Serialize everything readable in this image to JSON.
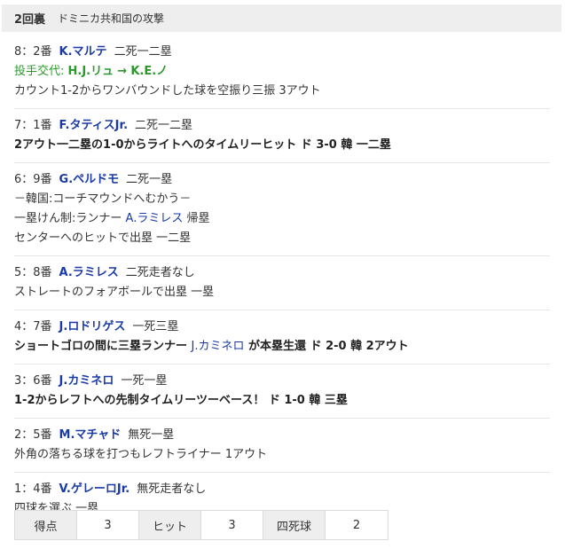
{
  "header": {
    "inning": "2回裏",
    "attack": "ドミニカ共和国の攻撃"
  },
  "entries": [
    {
      "num": "8：2番",
      "player": "K.マルテ",
      "situation": "二死一二塁",
      "sub": {
        "prefix": "投手交代:",
        "from": "H.J.リュ",
        "arrow": "→",
        "to": "K.E.ノ"
      },
      "result": "カウント1-2からワンバウンドした球を空振り三振 3アウト"
    },
    {
      "num": "7：1番",
      "player": "F.タティスJr.",
      "situation": "二死一二塁",
      "result": "2アウト一二塁の1-0からライトへのタイムリーヒット ド 3-0 韓 一二塁"
    },
    {
      "num": "6：9番",
      "player": "G.ペルドモ",
      "situation": "二死一塁",
      "notes": [
        "－韓国:コーチマウンドへむかう－"
      ],
      "pickoff": {
        "prefix": "一塁けん制:ランナー",
        "runner": "A.ラミレス",
        "suffix": "帰塁"
      },
      "result": "センターへのヒットで出塁 一二塁"
    },
    {
      "num": "5：8番",
      "player": "A.ラミレス",
      "situation": "二死走者なし",
      "result": "ストレートのフォアボールで出塁 一塁"
    },
    {
      "num": "4：7番",
      "player": "J.ロドリゲス",
      "situation": "一死三塁",
      "result_parts": {
        "a": "ショートゴロの間に三塁ランナー",
        "runner": "J.カミネロ",
        "b": "が本塁生還 ド 2-0 韓 2アウト"
      }
    },
    {
      "num": "3：6番",
      "player": "J.カミネロ",
      "situation": "一死一塁",
      "result": "1-2からレフトへの先制タイムリーツーベース！ ド 1-0 韓 三塁"
    },
    {
      "num": "2：5番",
      "player": "M.マチャド",
      "situation": "無死一塁",
      "result": "外角の落ちる球を打つもレフトライナー 1アウト"
    },
    {
      "num": "1：4番",
      "player": "V.ゲレーロJr.",
      "situation": "無死走者なし",
      "result": "四球を選ぶ 一塁"
    }
  ],
  "summary": {
    "runs_label": "得点",
    "runs": "3",
    "hits_label": "ヒット",
    "hits": "3",
    "walks_label": "四死球",
    "walks": "2"
  }
}
